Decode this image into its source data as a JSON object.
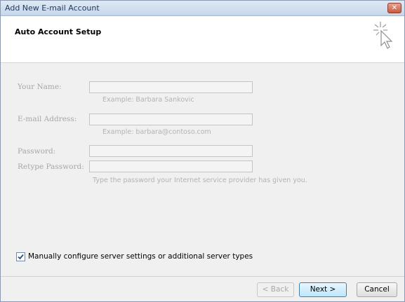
{
  "window": {
    "title": "Add New E-mail Account",
    "close_glyph": "✕"
  },
  "header": {
    "title": "Auto Account Setup",
    "icon": "cursor-sparkle-icon"
  },
  "form": {
    "name": {
      "label": "Your Name:",
      "value": "",
      "hint": "Example: Barbara Sankovic"
    },
    "email": {
      "label": "E-mail Address:",
      "value": "",
      "hint": "Example: barbara@contoso.com"
    },
    "password": {
      "label": "Password:",
      "value": ""
    },
    "retype_password": {
      "label": "Retype Password:",
      "value": "",
      "hint": "Type the password your Internet service provider has given you."
    }
  },
  "manual_config": {
    "checked": true,
    "label": "Manually configure server settings or additional server types"
  },
  "buttons": {
    "back": "< Back",
    "next": "Next >",
    "cancel": "Cancel"
  }
}
